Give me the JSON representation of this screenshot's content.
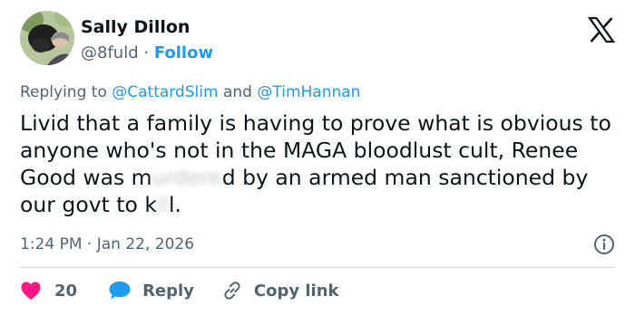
{
  "author": {
    "display_name": "Sally Dillon",
    "handle": "@8fuld",
    "separator": "·",
    "follow_label": "Follow"
  },
  "reply_context": {
    "prefix": "Replying to",
    "mention_1": "@CattardSlim",
    "conjunction": "and",
    "mention_2": "@TimHannan"
  },
  "tweet": {
    "text_1": "Livid that a family is having to prove what is obvious to anyone who's not in the MAGA bloodlust cult, Renee Good was m",
    "censored_1": "urdere",
    "text_2": "d by an armed man sanctioned by our govt to k",
    "censored_2": "il",
    "text_3": "l.",
    "timestamp": "1:24 PM · Jan 22, 2026"
  },
  "actions": {
    "like_count": "20",
    "reply_label": "Reply",
    "copy_link_label": "Copy link"
  },
  "icons": {
    "like": "heart-icon",
    "reply": "speech-bubble-icon",
    "copy": "link-icon",
    "info": "info-icon",
    "brand": "x-logo-icon"
  },
  "colors": {
    "accent": "#1d9bf0",
    "like": "#f91880",
    "muted": "#536471",
    "text": "#0f1419"
  }
}
